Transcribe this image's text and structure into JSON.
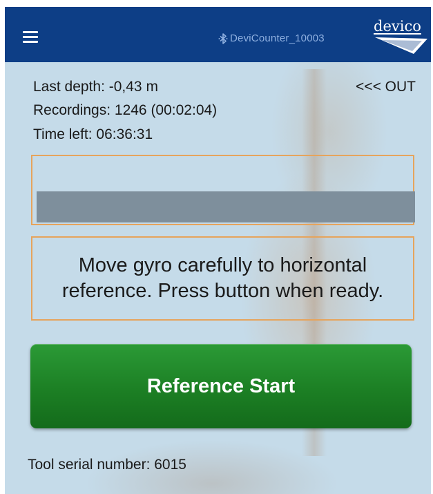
{
  "app_bar": {
    "device_name": "DeviCounter_10003",
    "logo_text": "devico",
    "icons": [
      "menu-icon",
      "bluetooth-icon"
    ],
    "color": "#0d3e86"
  },
  "status": {
    "last_depth": "Last depth: -0,43 m",
    "recordings": "Recordings: 1246 (00:02:04)",
    "time_left": "Time left: 06:36:31",
    "direction": "<<< OUT"
  },
  "progress": {
    "fraction": 1.0
  },
  "message": {
    "text": "Move gyro carefully to horizontal reference. Press button when ready."
  },
  "action": {
    "button_label": "Reference Start",
    "color": "#1c7f24"
  },
  "footer": {
    "tool_serial": "Tool serial number: 6015"
  },
  "colors": {
    "background": "#c5dbe9",
    "box_border": "#e6a45c"
  }
}
